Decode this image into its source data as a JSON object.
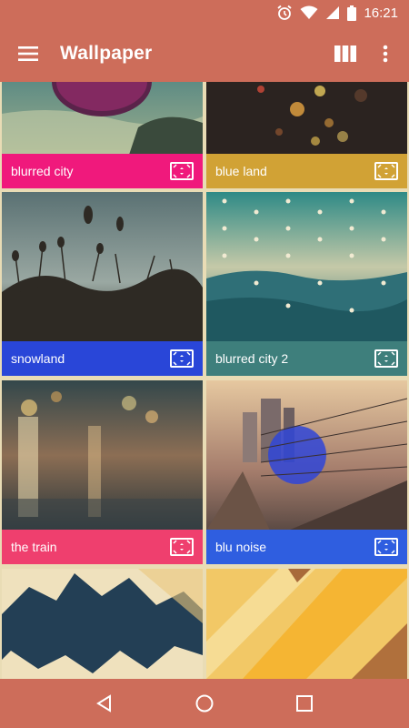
{
  "status_bar": {
    "time": "16:21"
  },
  "app_bar": {
    "title": "Wallpaper"
  },
  "colors": {
    "app_bar": "#cd6d5a",
    "background": "#e9dcb5"
  },
  "wallpapers": [
    {
      "name": "blurred city",
      "caption_color": "#f0197c"
    },
    {
      "name": "blue land",
      "caption_color": "#d1a235"
    },
    {
      "name": "snowland",
      "caption_color": "#2946d8"
    },
    {
      "name": "blurred city 2",
      "caption_color": "#3e7f7c"
    },
    {
      "name": "the train",
      "caption_color": "#ef3f6e"
    },
    {
      "name": "blu noise",
      "caption_color": "#2f5ee0"
    }
  ],
  "icons": {
    "menu": "hamburger-menu-icon",
    "view": "grid-view-icon",
    "overflow": "more-vert-icon",
    "apply": "set-wallpaper-icon",
    "back": "back-icon",
    "home": "home-icon",
    "recents": "recents-icon"
  }
}
